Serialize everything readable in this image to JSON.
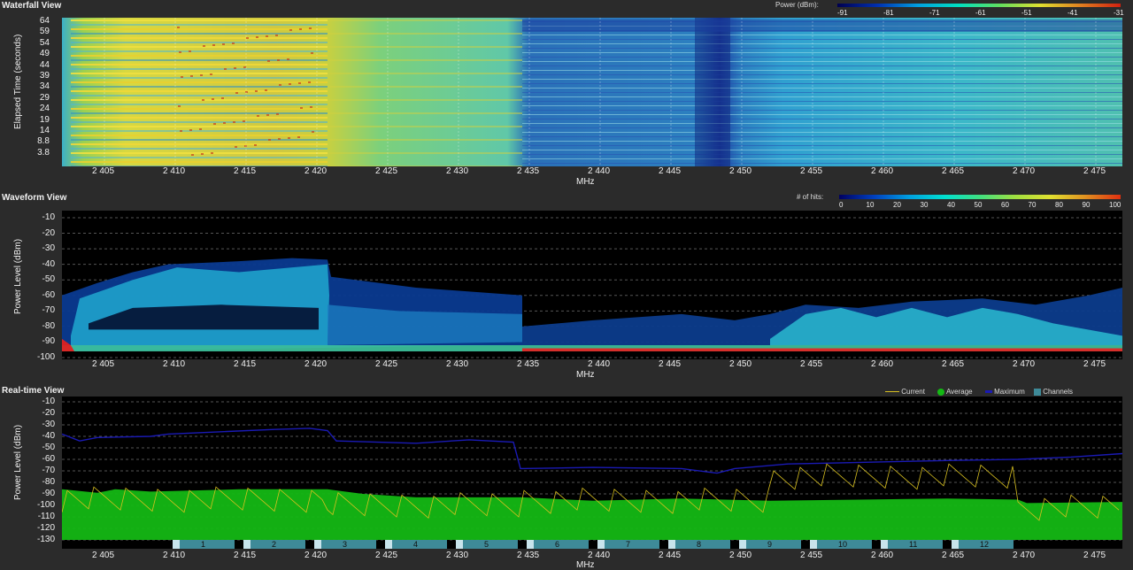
{
  "waterfall": {
    "title": "Waterfall View",
    "legend_label": "Power (dBm):",
    "legend_ticks": [
      "-91",
      "-81",
      "-71",
      "-61",
      "-51",
      "-41",
      "-31"
    ],
    "ylabel": "Elapsed Time (seconds)",
    "y_ticks": [
      "64",
      "59",
      "54",
      "49",
      "44",
      "39",
      "34",
      "29",
      "24",
      "19",
      "14",
      "8.8",
      "3.8"
    ],
    "xlabel": "MHz"
  },
  "waveform": {
    "title": "Waveform View",
    "legend_label": "# of hits:",
    "legend_ticks": [
      "0",
      "10",
      "20",
      "30",
      "40",
      "50",
      "60",
      "70",
      "80",
      "90",
      "100"
    ],
    "ylabel": "Power Level (dBm)",
    "y_ticks": [
      "-10",
      "-20",
      "-30",
      "-40",
      "-50",
      "-60",
      "-70",
      "-80",
      "-90",
      "-100"
    ],
    "xlabel": "MHz"
  },
  "realtime": {
    "title": "Real-time View",
    "legend": {
      "current": "Current",
      "average": "Average",
      "maximum": "Maximum",
      "channels": "Channels"
    },
    "ylabel": "Power Level (dBm)",
    "y_ticks": [
      "-10",
      "-20",
      "-30",
      "-40",
      "-50",
      "-60",
      "-70",
      "-80",
      "-90",
      "-100",
      "-110",
      "-120",
      "-130"
    ],
    "channels": [
      "1",
      "2",
      "3",
      "4",
      "5",
      "6",
      "7",
      "8",
      "9",
      "10",
      "11",
      "12"
    ],
    "xlabel": "MHz"
  },
  "x_ticks": [
    "2 405",
    "2 410",
    "2 415",
    "2 420",
    "2 425",
    "2 430",
    "2 435",
    "2 440",
    "2 445",
    "2 450",
    "2 455",
    "2 460",
    "2 465",
    "2 470",
    "2 475"
  ],
  "colors": {
    "current": "#d8c020",
    "average": "#14b814",
    "maximum": "#1a1ab4",
    "channels": "#3e8a98"
  }
}
